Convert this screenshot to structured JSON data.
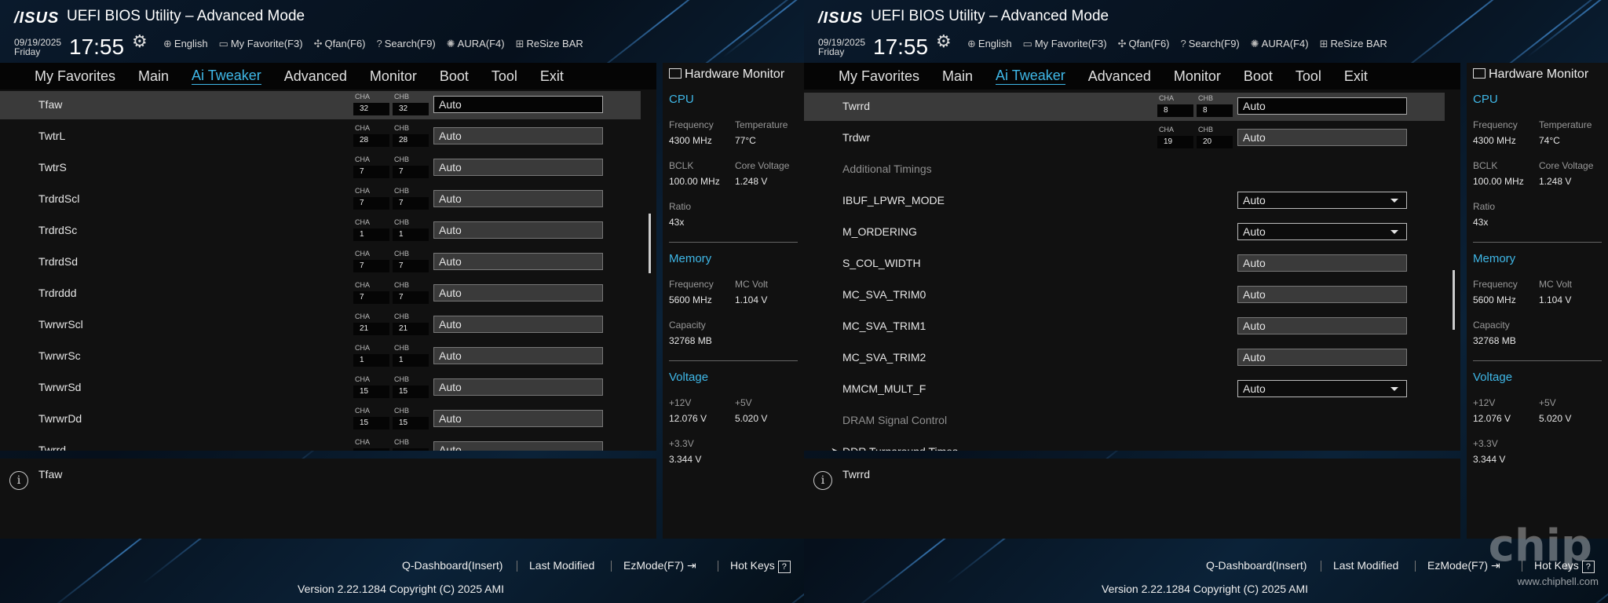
{
  "brand": "/ISUS",
  "title": "UEFI BIOS Utility – Advanced Mode",
  "date": "09/19/2025",
  "day": "Friday",
  "time": "17:55",
  "toolbar": [
    {
      "icon": "globe-icon",
      "glyph": "⊕",
      "label": "English"
    },
    {
      "icon": "favorite-icon",
      "glyph": "▭",
      "label": "My Favorite(F3)"
    },
    {
      "icon": "fan-icon",
      "glyph": "✣",
      "label": "Qfan(F6)"
    },
    {
      "icon": "search-icon",
      "glyph": "?",
      "label": "Search(F9)"
    },
    {
      "icon": "aura-icon",
      "glyph": "✺",
      "label": "AURA(F4)"
    },
    {
      "icon": "resize-bar-icon",
      "glyph": "⊞",
      "label": "ReSize BAR"
    }
  ],
  "tabs": [
    "My Favorites",
    "Main",
    "Ai Tweaker",
    "Advanced",
    "Monitor",
    "Boot",
    "Tool",
    "Exit"
  ],
  "active_tab": "Ai Tweaker",
  "left_panel": {
    "rows": [
      {
        "label": "Tfaw",
        "cha": "32",
        "chb": "32",
        "value": "Auto",
        "selected": true
      },
      {
        "label": "TwtrL",
        "cha": "28",
        "chb": "28",
        "value": "Auto"
      },
      {
        "label": "TwtrS",
        "cha": "7",
        "chb": "7",
        "value": "Auto"
      },
      {
        "label": "TrdrdScl",
        "cha": "7",
        "chb": "7",
        "value": "Auto"
      },
      {
        "label": "TrdrdSc",
        "cha": "1",
        "chb": "1",
        "value": "Auto"
      },
      {
        "label": "TrdrdSd",
        "cha": "7",
        "chb": "7",
        "value": "Auto"
      },
      {
        "label": "Trdrddd",
        "cha": "7",
        "chb": "7",
        "value": "Auto"
      },
      {
        "label": "TwrwrScl",
        "cha": "21",
        "chb": "21",
        "value": "Auto"
      },
      {
        "label": "TwrwrSc",
        "cha": "1",
        "chb": "1",
        "value": "Auto"
      },
      {
        "label": "TwrwrSd",
        "cha": "15",
        "chb": "15",
        "value": "Auto"
      },
      {
        "label": "TwrwrDd",
        "cha": "15",
        "chb": "15",
        "value": "Auto"
      },
      {
        "label": "Twrrd",
        "cha": "",
        "chb": "",
        "value": "Auto"
      }
    ],
    "info": "Tfaw",
    "hw": {
      "temperature": "77°C"
    }
  },
  "right_panel": {
    "rows": [
      {
        "label": "Twrrd",
        "cha": "8",
        "chb": "8",
        "value": "Auto",
        "selected": true
      },
      {
        "label": "Trdwr",
        "cha": "19",
        "chb": "20",
        "value": "Auto"
      },
      {
        "label": "Additional Timings",
        "section": true
      },
      {
        "label": "IBUF_LPWR_MODE",
        "value": "Auto",
        "dropdown": true
      },
      {
        "label": "M_ORDERING",
        "value": "Auto",
        "dropdown": true
      },
      {
        "label": "S_COL_WIDTH",
        "value": "Auto"
      },
      {
        "label": "MC_SVA_TRIM0",
        "value": "Auto"
      },
      {
        "label": "MC_SVA_TRIM1",
        "value": "Auto"
      },
      {
        "label": "MC_SVA_TRIM2",
        "value": "Auto"
      },
      {
        "label": "MMCM_MULT_F",
        "value": "Auto",
        "dropdown": true
      },
      {
        "label": "DRAM Signal Control",
        "section": true
      },
      {
        "label": "DDR Turnaround Times",
        "expand": true
      }
    ],
    "info": "Twrrd",
    "hw": {
      "temperature": "74°C"
    }
  },
  "ch_labels": {
    "a": "CHA",
    "b": "CHB"
  },
  "hardware_monitor": {
    "title": "Hardware Monitor",
    "cpu_title": "CPU",
    "frequency_label": "Frequency",
    "frequency": "4300 MHz",
    "temperature_label": "Temperature",
    "bclk_label": "BCLK",
    "bclk": "100.00 MHz",
    "core_voltage_label": "Core Voltage",
    "core_voltage": "1.248 V",
    "ratio_label": "Ratio",
    "ratio": "43x",
    "memory_title": "Memory",
    "mem_frequency_label": "Frequency",
    "mem_frequency": "5600 MHz",
    "mc_volt_label": "MC Volt",
    "mc_volt": "1.104 V",
    "capacity_label": "Capacity",
    "capacity": "32768 MB",
    "voltage_title": "Voltage",
    "v12_label": "+12V",
    "v12": "12.076 V",
    "v5_label": "+5V",
    "v5": "5.020 V",
    "v33_label": "+3.3V",
    "v33": "3.344 V"
  },
  "footer": {
    "qdashboard": "Q-Dashboard(Insert)",
    "last_modified": "Last Modified",
    "ezmode": "EzMode(F7)",
    "hotkeys": "Hot Keys",
    "version": "Version 2.22.1284 Copyright (C) 2025 AMI"
  },
  "watermark": {
    "text": "www.chiphell.com",
    "logo": "chip hell"
  }
}
